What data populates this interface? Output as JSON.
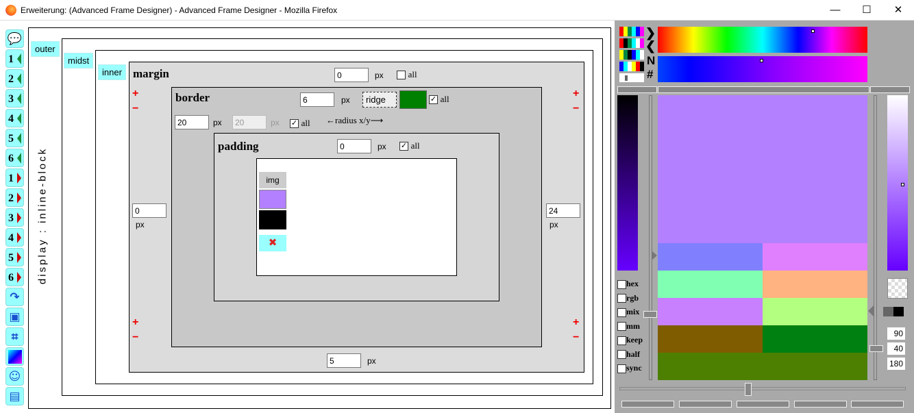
{
  "window": {
    "title": "Erweiterung: (Advanced Frame Designer) - Advanced Frame Designer - Mozilla Firefox",
    "minimize": "—",
    "maximize": "☐",
    "close": "✕"
  },
  "toolbar": {
    "buttons": [
      {
        "label": "",
        "icon": "info-bubble-icon"
      },
      {
        "label": "1",
        "icon": "arrow-left-green-icon"
      },
      {
        "label": "2",
        "icon": "arrow-left-green-icon"
      },
      {
        "label": "3",
        "icon": "arrow-left-green-icon"
      },
      {
        "label": "4",
        "icon": "arrow-left-green-icon"
      },
      {
        "label": "5",
        "icon": "arrow-left-green-icon"
      },
      {
        "label": "6",
        "icon": "arrow-left-green-icon"
      },
      {
        "label": "1",
        "icon": "arrow-right-red-icon"
      },
      {
        "label": "2",
        "icon": "arrow-right-red-icon"
      },
      {
        "label": "3",
        "icon": "arrow-right-red-icon"
      },
      {
        "label": "4",
        "icon": "arrow-right-red-icon"
      },
      {
        "label": "5",
        "icon": "arrow-right-red-icon"
      },
      {
        "label": "6",
        "icon": "arrow-right-red-icon"
      },
      {
        "label": "",
        "icon": "redo-clear-icon"
      },
      {
        "label": "",
        "icon": "layers-icon"
      },
      {
        "label": "",
        "icon": "frame-icon"
      },
      {
        "label": "",
        "icon": "gradient-icon"
      },
      {
        "label": "",
        "icon": "face-icon"
      },
      {
        "label": "",
        "icon": "notepad-icon"
      }
    ]
  },
  "designer": {
    "display_text": "display : inline-block",
    "outer_label": "outer",
    "midst_label": "midst",
    "inner_label": "inner",
    "margin": {
      "title": "margin",
      "value": "0",
      "unit": "px",
      "all_label": "all",
      "all_checked": false,
      "left": "0",
      "right": "24",
      "bottom": "5",
      "plus": "+",
      "minus": "−"
    },
    "border": {
      "title": "border",
      "value": "6",
      "unit": "px",
      "style": "ridge",
      "color": "#008000",
      "all_label": "all",
      "all_checked": true,
      "radius_x": "20",
      "radius_y": "20",
      "radius_all_checked": true,
      "radius_label": "←radius x/y⟶"
    },
    "padding": {
      "title": "padding",
      "value": "0",
      "unit": "px",
      "all_label": "all",
      "all_checked": true
    },
    "content": {
      "img_label": "img",
      "bg_color": "#b380ff",
      "fg_color": "#000000",
      "delete_icon": "✖"
    }
  },
  "color_panel": {
    "nav_symbols": [
      "N",
      "#"
    ],
    "main_color": "#b380ff",
    "swatches": [
      "#8080ff",
      "#e080ff",
      "#80ffb3",
      "#ffb380",
      "#c880ff",
      "#b3ff80",
      "#805c00",
      "#008010",
      "#4d8000"
    ],
    "options": [
      {
        "label": "hex",
        "checked": false
      },
      {
        "label": "rgb",
        "checked": false
      },
      {
        "label": "mix",
        "checked": false
      },
      {
        "label": "mm",
        "checked": false
      },
      {
        "label": "keep",
        "checked": false
      },
      {
        "label": "half",
        "checked": false
      },
      {
        "label": "sync",
        "checked": false
      }
    ],
    "values": [
      "90",
      "40",
      "180"
    ]
  }
}
